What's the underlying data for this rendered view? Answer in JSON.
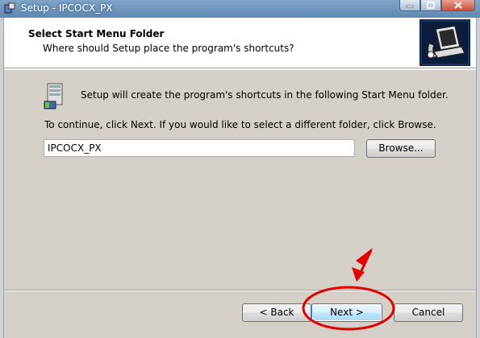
{
  "window": {
    "title": "Setup - IPCOCX_PX"
  },
  "header": {
    "title": "Select Start Menu Folder",
    "subtitle": "Where should Setup place the program's shortcuts?"
  },
  "body": {
    "message": "Setup will create the program's shortcuts in the following Start Menu folder.",
    "instruction": "To continue, click Next. If you would like to select a different folder, click Browse.",
    "folder_value": "IPCOCX_PX",
    "browse_label": "Browse..."
  },
  "footer": {
    "back_label": "< Back",
    "next_label": "Next >",
    "cancel_label": "Cancel"
  },
  "annotation": {
    "color": "#e00000",
    "shape": "red-ellipse-with-arrow-highlighting-next"
  }
}
